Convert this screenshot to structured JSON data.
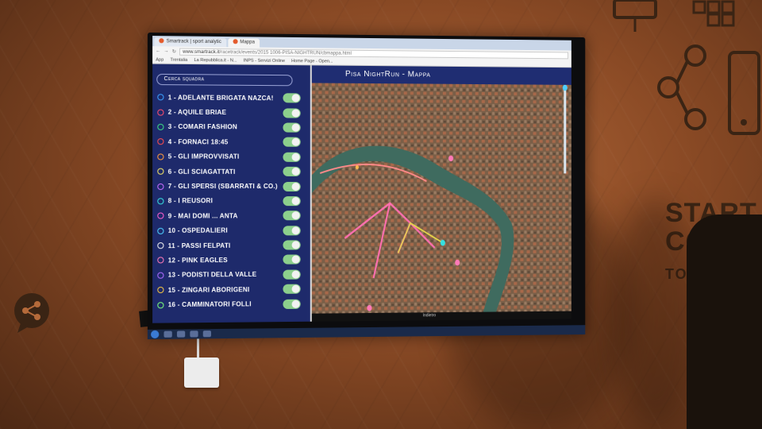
{
  "browser": {
    "tabs": [
      "Smartrack | sport analytic",
      "Mappa"
    ],
    "url_prefix": "www.smartrack.it",
    "url_path": "/racetrack/events/2015 1006-PISA-NIGHTRUN/cbmappa.html",
    "bookmarks": [
      "App",
      "Trentalia",
      "La Repubblica.it - N...",
      "INPS - Servizi Online",
      "Home Page - Open..."
    ]
  },
  "sidebar": {
    "search_placeholder": "Cerca squadra",
    "teams": [
      {
        "label": "1 - ADELANTE BRIGATA NAZCA!",
        "color": "#3aa0ff"
      },
      {
        "label": "2 - AQUILE BRIAE",
        "color": "#ff4d6d"
      },
      {
        "label": "3 - COMARI FASHION",
        "color": "#3ddc84"
      },
      {
        "label": "4 - FORNACI 18:45",
        "color": "#ff4d4d"
      },
      {
        "label": "5 - GLI IMPROVVISATI",
        "color": "#ff9a3c"
      },
      {
        "label": "6 - GLI SCIAGATTATI",
        "color": "#f5e663"
      },
      {
        "label": "7 - GLI SPERSI (SBARRATI & CO.)",
        "color": "#c86bff"
      },
      {
        "label": "8 - I REUSORI",
        "color": "#35e0e0"
      },
      {
        "label": "9 - MAI DOMI ... ANTA",
        "color": "#ff5ecf"
      },
      {
        "label": "10 - OSPEDALIERI",
        "color": "#4dd0ff"
      },
      {
        "label": "11 - PASSI FELPATI",
        "color": "#f0f0f0"
      },
      {
        "label": "12 - PINK EAGLES",
        "color": "#ff7ab8"
      },
      {
        "label": "13 - PODISTI DELLA VALLE",
        "color": "#b06bff"
      },
      {
        "label": "15 - ZINGARI ABORIGENI",
        "color": "#f5c542"
      },
      {
        "label": "16 - CAMMINATORI FOLLI",
        "color": "#7bff7b"
      }
    ]
  },
  "map": {
    "title": "Pisa NightRun - Mappa",
    "status_label": "Indietro"
  },
  "wall": {
    "line1": "START A",
    "line2": "CONTE",
    "line3": "TOSCA"
  }
}
